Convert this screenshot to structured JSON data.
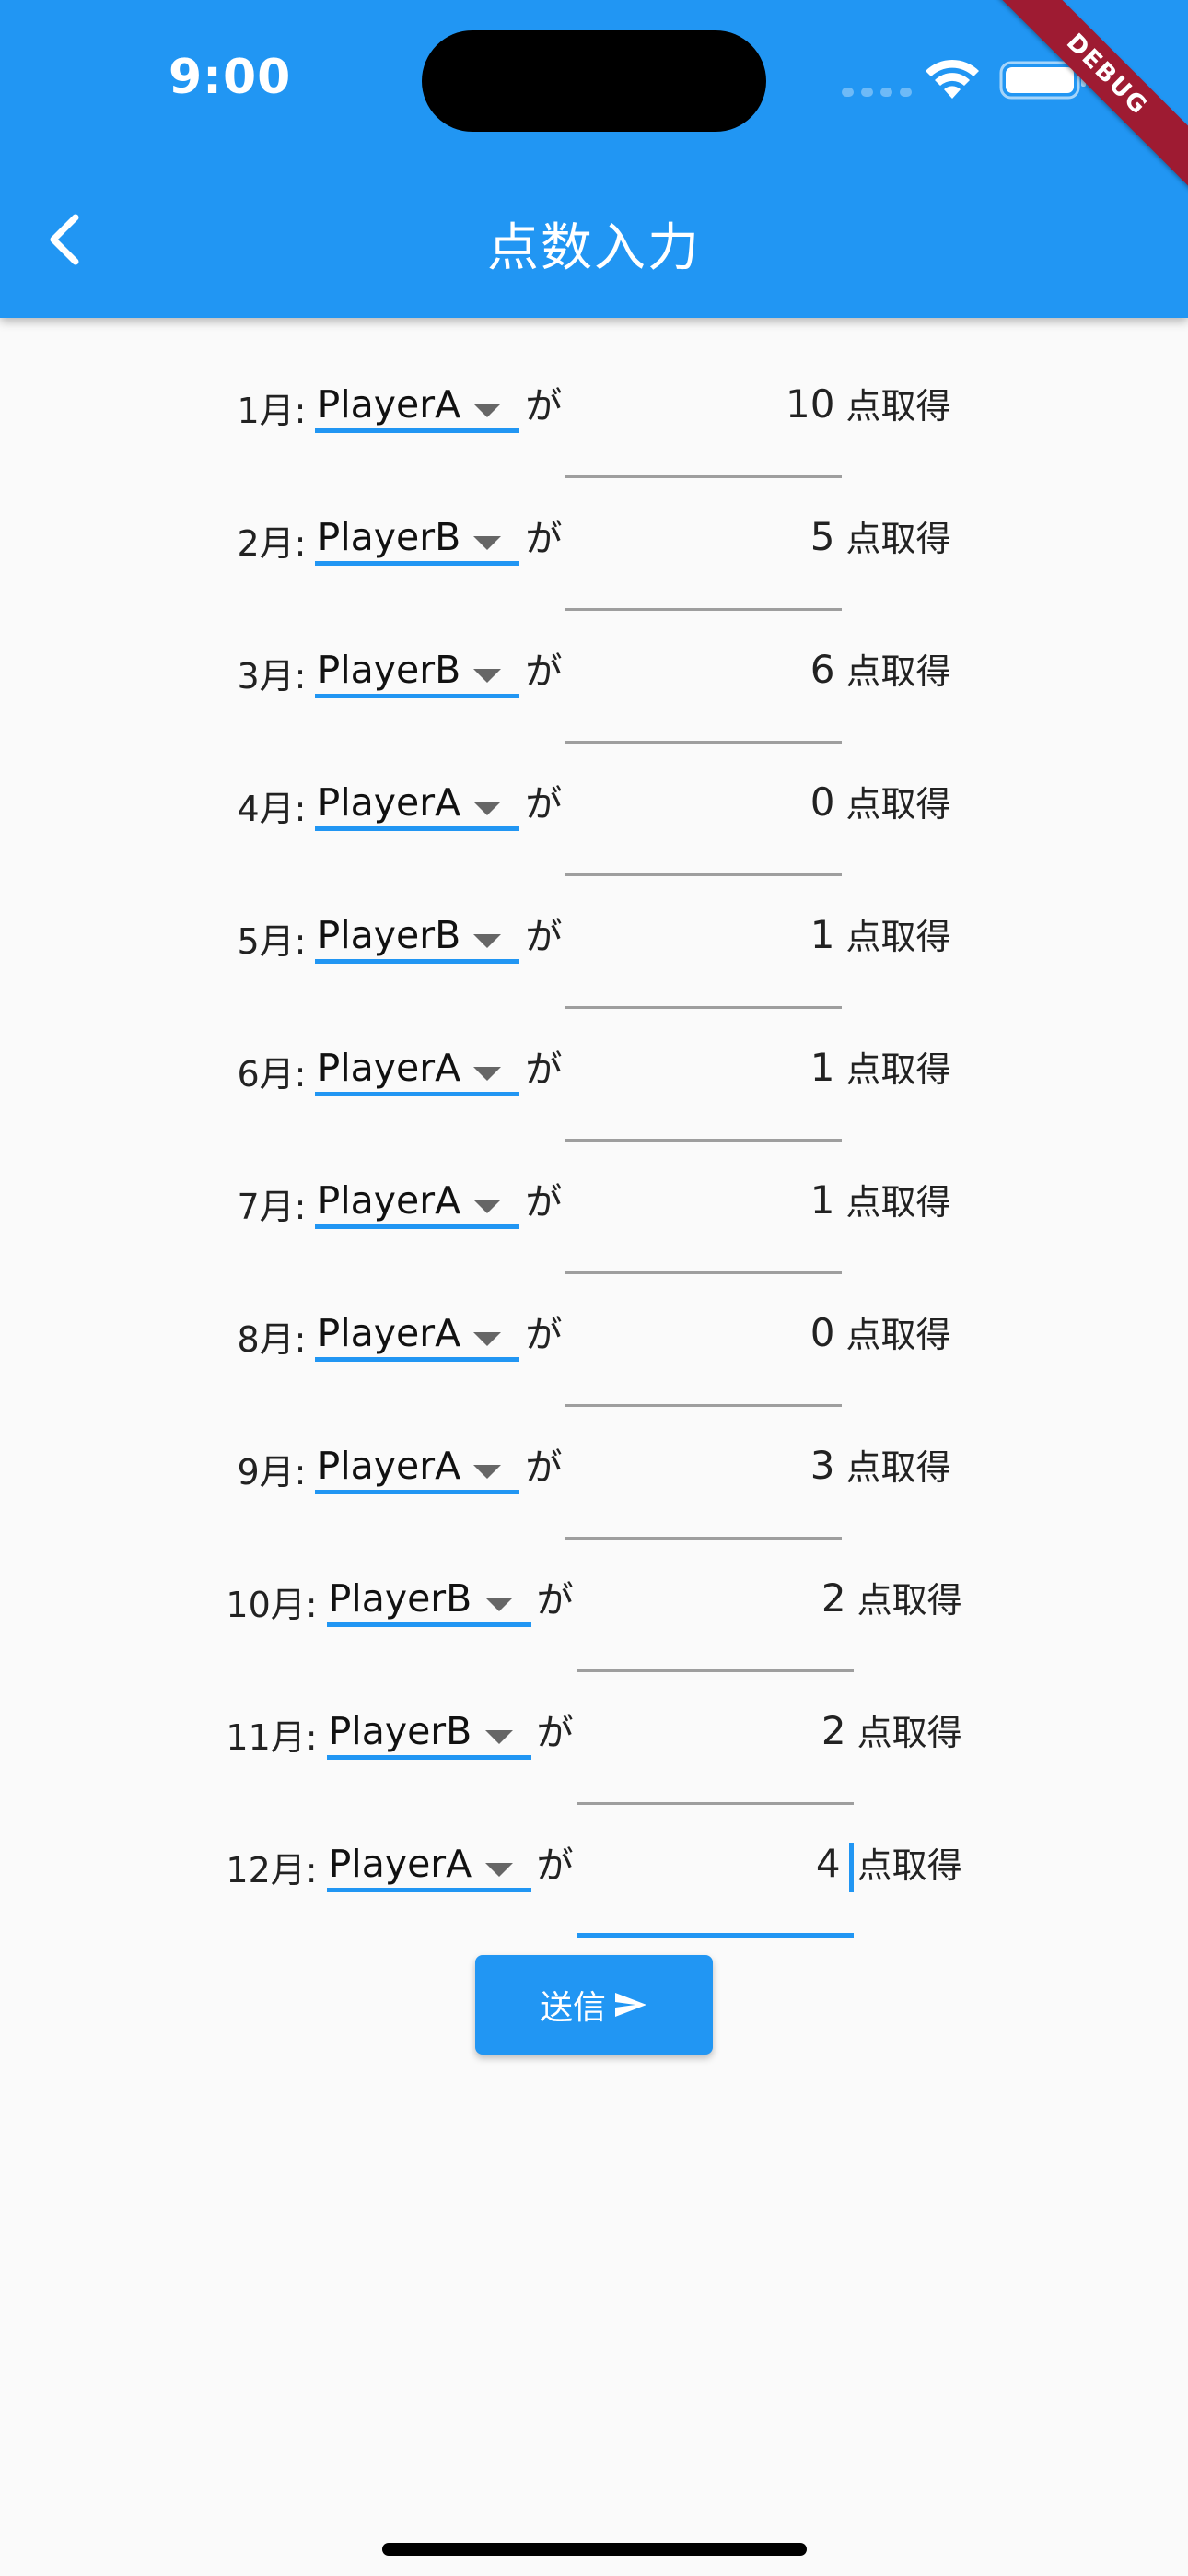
{
  "status_bar": {
    "time": "9:00"
  },
  "debug_banner": "DEBUG",
  "app_bar": {
    "title": "点数入力",
    "back_icon": "chevron-left-icon"
  },
  "colors": {
    "primary": "#2196f3",
    "background": "#fafafa",
    "underline_inactive": "#9e9e9e",
    "debug_banner": "#9e1b32"
  },
  "connector_label": "が",
  "suffix_label": "点取得",
  "rows": [
    {
      "month": "1月:",
      "player": "PlayerA",
      "score": "10"
    },
    {
      "month": "2月:",
      "player": "PlayerB",
      "score": "5"
    },
    {
      "month": "3月:",
      "player": "PlayerB",
      "score": "6"
    },
    {
      "month": "4月:",
      "player": "PlayerA",
      "score": "0"
    },
    {
      "month": "5月:",
      "player": "PlayerB",
      "score": "1"
    },
    {
      "month": "6月:",
      "player": "PlayerA",
      "score": "1"
    },
    {
      "month": "7月:",
      "player": "PlayerA",
      "score": "1"
    },
    {
      "month": "8月:",
      "player": "PlayerA",
      "score": "0"
    },
    {
      "month": "9月:",
      "player": "PlayerA",
      "score": "3"
    },
    {
      "month": "10月:",
      "player": "PlayerB",
      "score": "2"
    },
    {
      "month": "11月:",
      "player": "PlayerB",
      "score": "2"
    },
    {
      "month": "12月:",
      "player": "PlayerA",
      "score": "4"
    }
  ],
  "focused_row": 11,
  "submit": {
    "label": "送信",
    "icon": "send-icon"
  }
}
